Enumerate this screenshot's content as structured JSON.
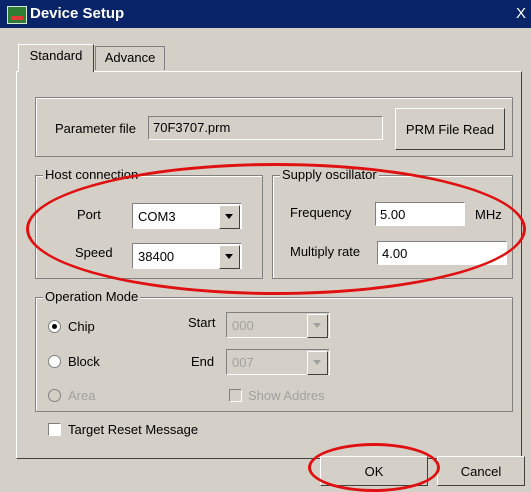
{
  "window": {
    "title": "Device Setup",
    "close_glyph": "X",
    "icon": "app-chip-icon"
  },
  "tabs": [
    {
      "label": "Standard",
      "active": true
    },
    {
      "label": "Advance",
      "active": false
    }
  ],
  "parameter": {
    "label": "Parameter file",
    "value": "70F3707.prm",
    "read_button": "PRM File Read"
  },
  "host": {
    "title": "Host connection",
    "port_label": "Port",
    "port_value": "COM3",
    "speed_label": "Speed",
    "speed_value": "38400"
  },
  "oscillator": {
    "title": "Supply oscillator",
    "frequency_label": "Frequency",
    "frequency_value": "5.00",
    "frequency_unit": "MHz",
    "multiply_label": "Multiply rate",
    "multiply_value": "4.00"
  },
  "operation": {
    "title": "Operation Mode",
    "chip": "Chip",
    "block": "Block",
    "area": "Area",
    "selected": "Chip",
    "start_label": "Start",
    "start_value": "000",
    "end_label": "End",
    "end_value": "007",
    "show_address": "Show Addres"
  },
  "target_reset": {
    "label": "Target Reset Message",
    "checked": false
  },
  "buttons": {
    "ok": "OK",
    "cancel": "Cancel"
  },
  "colors": {
    "titlebar": "#0a246a",
    "face": "#d4d0c8",
    "annotation": "#e01010"
  }
}
